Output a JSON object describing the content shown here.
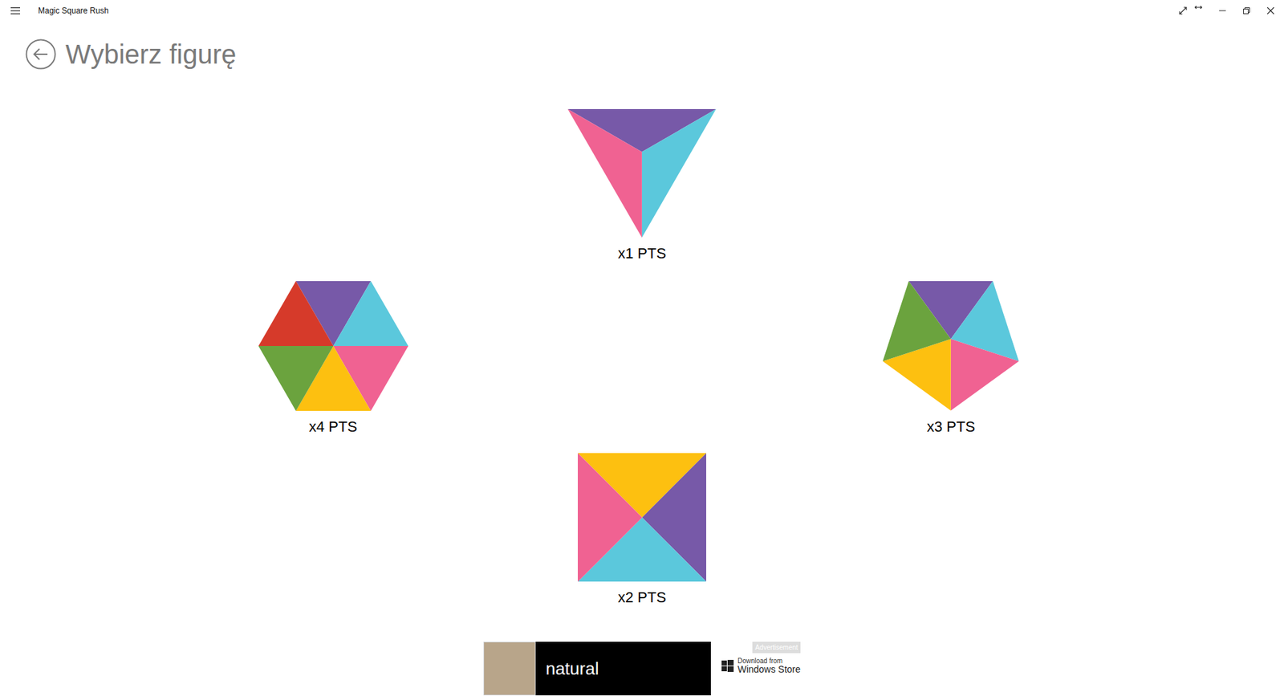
{
  "window": {
    "title": "Magic Square Rush"
  },
  "header": {
    "title": "Wybierz figurę"
  },
  "figures": [
    {
      "kind": "triangle",
      "label": "x1 PTS",
      "segments": [
        {
          "color": "#7759a8"
        },
        {
          "color": "#5bc8dc"
        },
        {
          "color": "#f06292"
        }
      ]
    },
    {
      "kind": "hexagon",
      "label": "x4 PTS",
      "segments": [
        {
          "color": "#7759a8"
        },
        {
          "color": "#5bc8dc"
        },
        {
          "color": "#f06292"
        },
        {
          "color": "#fdc010"
        },
        {
          "color": "#6ba33e"
        },
        {
          "color": "#d63a2a"
        }
      ]
    },
    {
      "kind": "pentagon",
      "label": "x3 PTS",
      "segments": [
        {
          "color": "#7759a8"
        },
        {
          "color": "#5bc8dc"
        },
        {
          "color": "#f06292"
        },
        {
          "color": "#fdc010"
        },
        {
          "color": "#6ba33e"
        }
      ]
    },
    {
      "kind": "square",
      "label": "x2 PTS",
      "segments": [
        {
          "color": "#fdc010"
        },
        {
          "color": "#7759a8"
        },
        {
          "color": "#5bc8dc"
        },
        {
          "color": "#f06292"
        }
      ]
    }
  ],
  "ad": {
    "text": "natural",
    "badge": "Advertisement",
    "store_line1": "Download from",
    "store_line2": "Windows Store"
  }
}
